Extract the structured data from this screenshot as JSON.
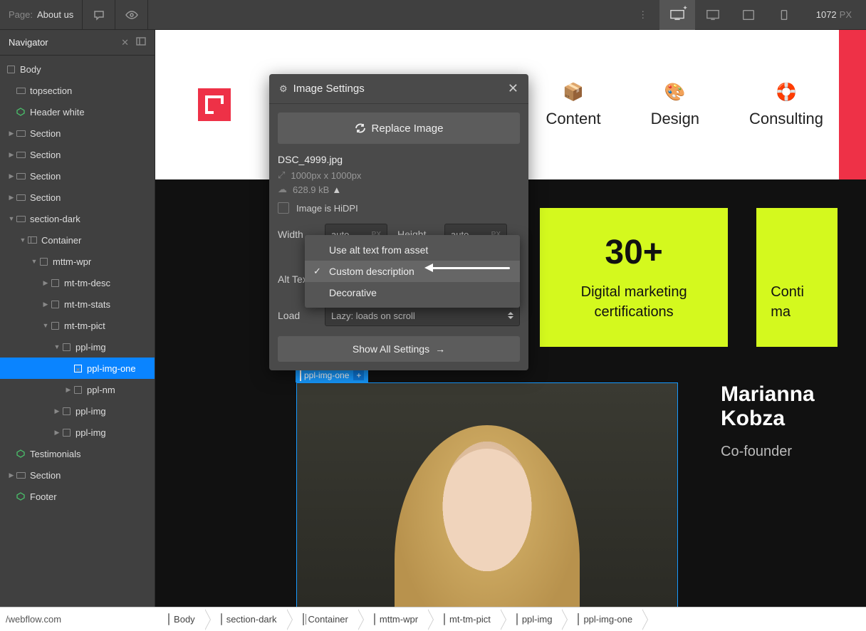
{
  "topbar": {
    "page_label": "Page:",
    "page_name": "About us",
    "viewport_width": "1072",
    "viewport_unit": "PX"
  },
  "navigator": {
    "title": "Navigator",
    "tree": {
      "body": "Body",
      "topsection": "topsection",
      "header_white": "Header white",
      "section": "Section",
      "section_dark": "section-dark",
      "container": "Container",
      "mttm_wpr": "mttm-wpr",
      "mt_tm_desc": "mt-tm-desc",
      "mt_tm_stats": "mt-tm-stats",
      "mt_tm_pict": "mt-tm-pict",
      "ppl_img": "ppl-img",
      "ppl_img_one": "ppl-img-one",
      "ppl_nm": "ppl-nm",
      "testimonials": "Testimonials",
      "footer": "Footer"
    }
  },
  "site_nav": {
    "content": "Content",
    "design": "Design",
    "consulting": "Consulting"
  },
  "stats": {
    "s1_num": "30+",
    "s1_desc1": "Digital marketing",
    "s1_desc2": "certifications",
    "s2_desc1": "Conti",
    "s2_desc2": "ma"
  },
  "person": {
    "tag": "ppl-img-one",
    "name": "Marianna Kobza",
    "role": "Co-founder"
  },
  "modal": {
    "title": "Image Settings",
    "replace": "Replace Image",
    "filename": "DSC_4999.jpg",
    "dimensions": "1000px x 1000px",
    "size": "628.9 kB",
    "hidpi": "Image is HiDPI",
    "width_label": "Width",
    "width_val": "auto",
    "height_label": "Height",
    "height_val": "auto",
    "px": "PX",
    "alt_label": "Alt Text",
    "load_label": "Load",
    "load_val": "Lazy: loads on scroll",
    "show_all": "Show All Settings"
  },
  "dropdown": {
    "opt1": "Use alt text from asset",
    "opt2": "Custom description",
    "opt3": "Decorative"
  },
  "breadcrumbs": {
    "b1": "Body",
    "b2": "section-dark",
    "b3": "Container",
    "b4": "mttm-wpr",
    "b5": "mt-tm-pict",
    "b6": "ppl-img",
    "b7": "ppl-img-one"
  },
  "footer_url": "/webflow.com"
}
